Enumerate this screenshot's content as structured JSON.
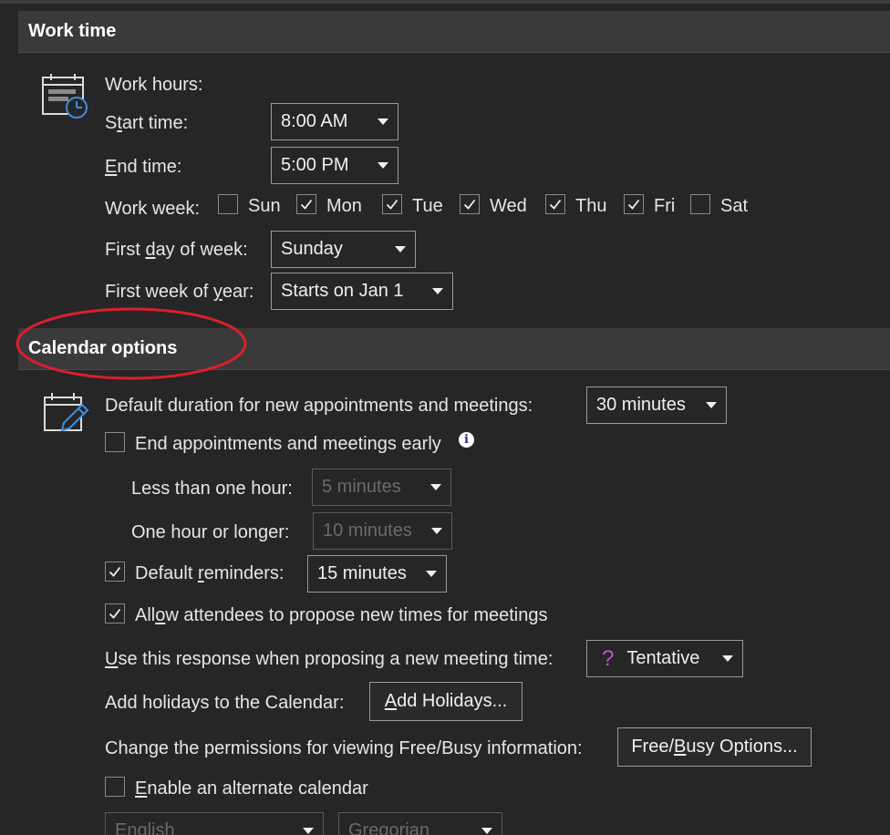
{
  "work_time": {
    "title": "Work time",
    "work_hours_label": "Work hours:",
    "start_time": {
      "label_pre": "S",
      "label_u": "t",
      "label_post": "art time:",
      "value": "8:00 AM"
    },
    "end_time": {
      "label_pre": "",
      "label_u": "E",
      "label_post": "nd time:",
      "value": "5:00 PM"
    },
    "work_week": {
      "label": "Work week:",
      "days": [
        {
          "name": "Sun",
          "checked": false
        },
        {
          "name": "Mon",
          "checked": true
        },
        {
          "name": "Tue",
          "checked": true
        },
        {
          "name": "Wed",
          "checked": true
        },
        {
          "name": "Thu",
          "checked": true
        },
        {
          "name": "Fri",
          "checked": true
        },
        {
          "name": "Sat",
          "checked": false
        }
      ]
    },
    "first_day": {
      "label_pre": "First ",
      "label_u": "d",
      "label_post": "ay of week:",
      "value": "Sunday"
    },
    "first_week": {
      "label_pre": "First week of ",
      "label_u": "y",
      "label_post": "ear:",
      "value": "Starts on Jan 1"
    }
  },
  "calendar_options": {
    "title": "Calendar options",
    "default_duration": {
      "label": "Default duration for new appointments and meetings:",
      "value": "30 minutes"
    },
    "end_early": {
      "label": "End appointments and meetings early",
      "checked": false
    },
    "less_than_hour": {
      "label": "Less than one hour:",
      "value": "5 minutes"
    },
    "hour_or_longer": {
      "label": "One hour or longer:",
      "value": "10 minutes"
    },
    "default_reminders": {
      "label_pre": "Default ",
      "label_u": "r",
      "label_post": "eminders:",
      "value": "15 minutes",
      "checked": true
    },
    "allow_propose": {
      "label_pre": "All",
      "label_u": "o",
      "label_post": "w attendees to propose new times for meetings",
      "checked": true
    },
    "use_response": {
      "label_pre": "",
      "label_u": "U",
      "label_post": "se this response when proposing a new meeting time:",
      "value": "Tentative",
      "icon": "?"
    },
    "holidays": {
      "label": "Add holidays to the Calendar:",
      "button_pre": "",
      "button_u": "A",
      "button_post": "dd Holidays..."
    },
    "permissions": {
      "label": "Change the permissions for viewing Free/Busy information:",
      "button_pre": "Free/",
      "button_u": "B",
      "button_post": "usy Options..."
    },
    "alternate": {
      "label_pre": "",
      "label_u": "E",
      "label_post": "nable an alternate calendar",
      "checked": false
    },
    "alt_language": "English",
    "alt_calendar": "Gregorian"
  },
  "colors": {
    "annotation": "#d9202a",
    "icon_blue": "#3b8fe0"
  }
}
